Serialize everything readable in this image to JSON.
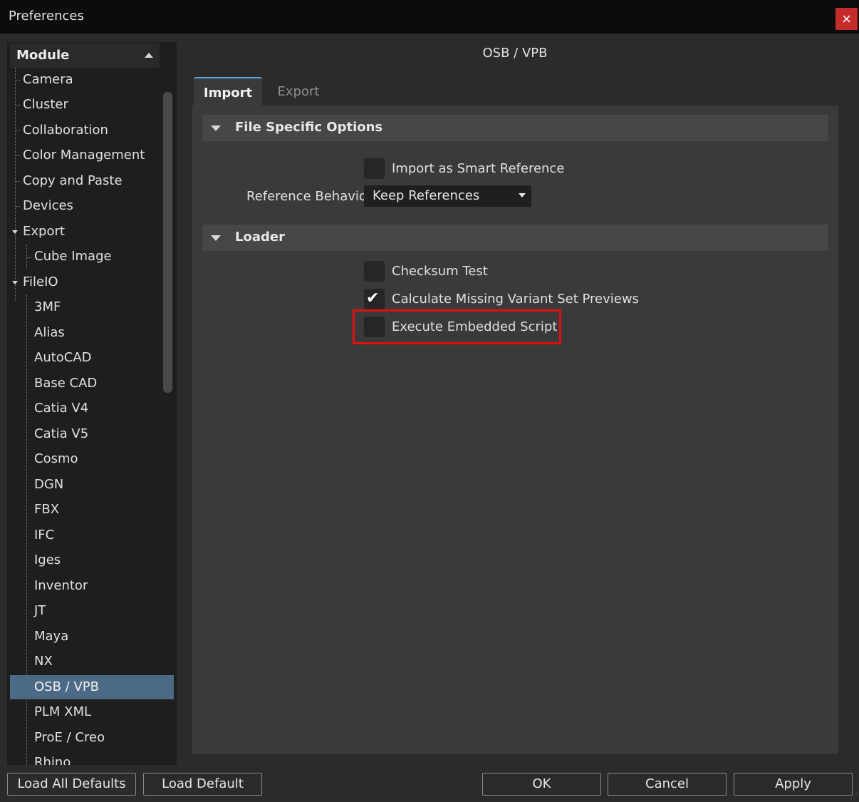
{
  "window": {
    "title": "Preferences",
    "close_label": "×"
  },
  "sidebar": {
    "header": "Module",
    "items": [
      {
        "label": "Camera"
      },
      {
        "label": "Cluster"
      },
      {
        "label": "Collaboration"
      },
      {
        "label": "Color Management"
      },
      {
        "label": "Copy and Paste"
      },
      {
        "label": "Devices"
      },
      {
        "label": "Export"
      },
      {
        "label": "Cube Image"
      },
      {
        "label": "FileIO"
      },
      {
        "label": "3MF"
      },
      {
        "label": "Alias"
      },
      {
        "label": "AutoCAD"
      },
      {
        "label": "Base CAD"
      },
      {
        "label": "Catia V4"
      },
      {
        "label": "Catia V5"
      },
      {
        "label": "Cosmo"
      },
      {
        "label": "DGN"
      },
      {
        "label": "FBX"
      },
      {
        "label": "IFC"
      },
      {
        "label": "Iges"
      },
      {
        "label": "Inventor"
      },
      {
        "label": "JT"
      },
      {
        "label": "Maya"
      },
      {
        "label": "NX"
      },
      {
        "label": "OSB / VPB"
      },
      {
        "label": "PLM XML"
      },
      {
        "label": "ProE / Creo"
      },
      {
        "label": "Rhino"
      }
    ],
    "selected": "OSB / VPB"
  },
  "panel": {
    "title": "OSB / VPB",
    "tabs": [
      {
        "label": "Import"
      },
      {
        "label": "Export"
      }
    ],
    "active_tab": "Import",
    "sections": [
      {
        "title": "File Specific Options",
        "import_smart_ref": {
          "label": "Import as Smart Reference",
          "checked": false
        },
        "reference_behavior": {
          "label": "Reference Behavior",
          "value": "Keep References"
        }
      },
      {
        "title": "Loader",
        "checksum": {
          "label": "Checksum Test",
          "checked": false
        },
        "variant_previews": {
          "label": "Calculate Missing Variant Set Previews",
          "checked": true,
          "check_glyph": "✔"
        },
        "embedded_script": {
          "label": "Execute Embedded Script",
          "checked": false
        }
      }
    ]
  },
  "buttons": {
    "load_all_defaults": "Load All Defaults",
    "load_default": "Load Default",
    "ok": "OK",
    "cancel": "Cancel",
    "apply": "Apply"
  },
  "colors": {
    "accent": "#5fa3d8",
    "selection": "#4c6a85",
    "highlight_box": "#e01010",
    "close_button": "#c42b2b"
  }
}
